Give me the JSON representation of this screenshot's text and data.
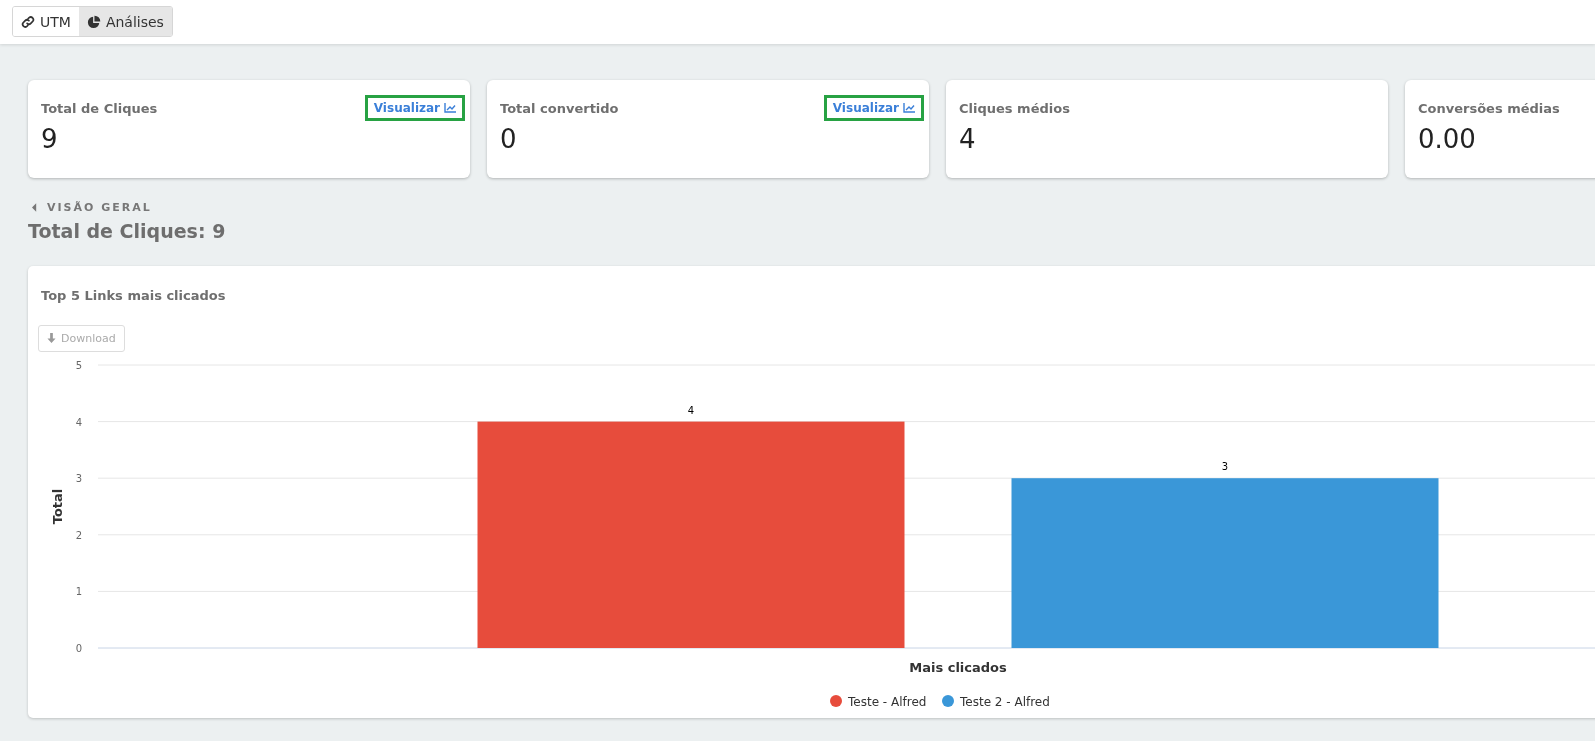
{
  "tabs": [
    {
      "label": "UTM",
      "selected": false
    },
    {
      "label": "Análises",
      "selected": true
    }
  ],
  "stats": [
    {
      "label": "Total de Cliques",
      "value": "9",
      "action": "Visualizar"
    },
    {
      "label": "Total convertido",
      "value": "0",
      "action": "Visualizar"
    },
    {
      "label": "Cliques médios",
      "value": "4"
    },
    {
      "label": "Conversões médias",
      "value": "0.00"
    }
  ],
  "breadcrumb": "VISÃO GERAL",
  "heading": "Total de Cliques: 9",
  "panel": {
    "title": "Top 5 Links mais clicados",
    "download": "Download",
    "chart_data": {
      "type": "bar",
      "xlabel": "Mais clicados",
      "ylabel": "Total",
      "grid": true,
      "legend": "bottom",
      "series": [
        {
          "name": "Teste - Alfred",
          "color": "#e74c3c",
          "values": [
            4
          ]
        },
        {
          "name": "Teste 2 - Alfred",
          "color": "#3a97d8",
          "values": [
            3
          ]
        }
      ],
      "ylim": [
        0,
        5
      ],
      "yticks": [
        0,
        1,
        2,
        3,
        4,
        5
      ],
      "data_labels": true
    }
  }
}
